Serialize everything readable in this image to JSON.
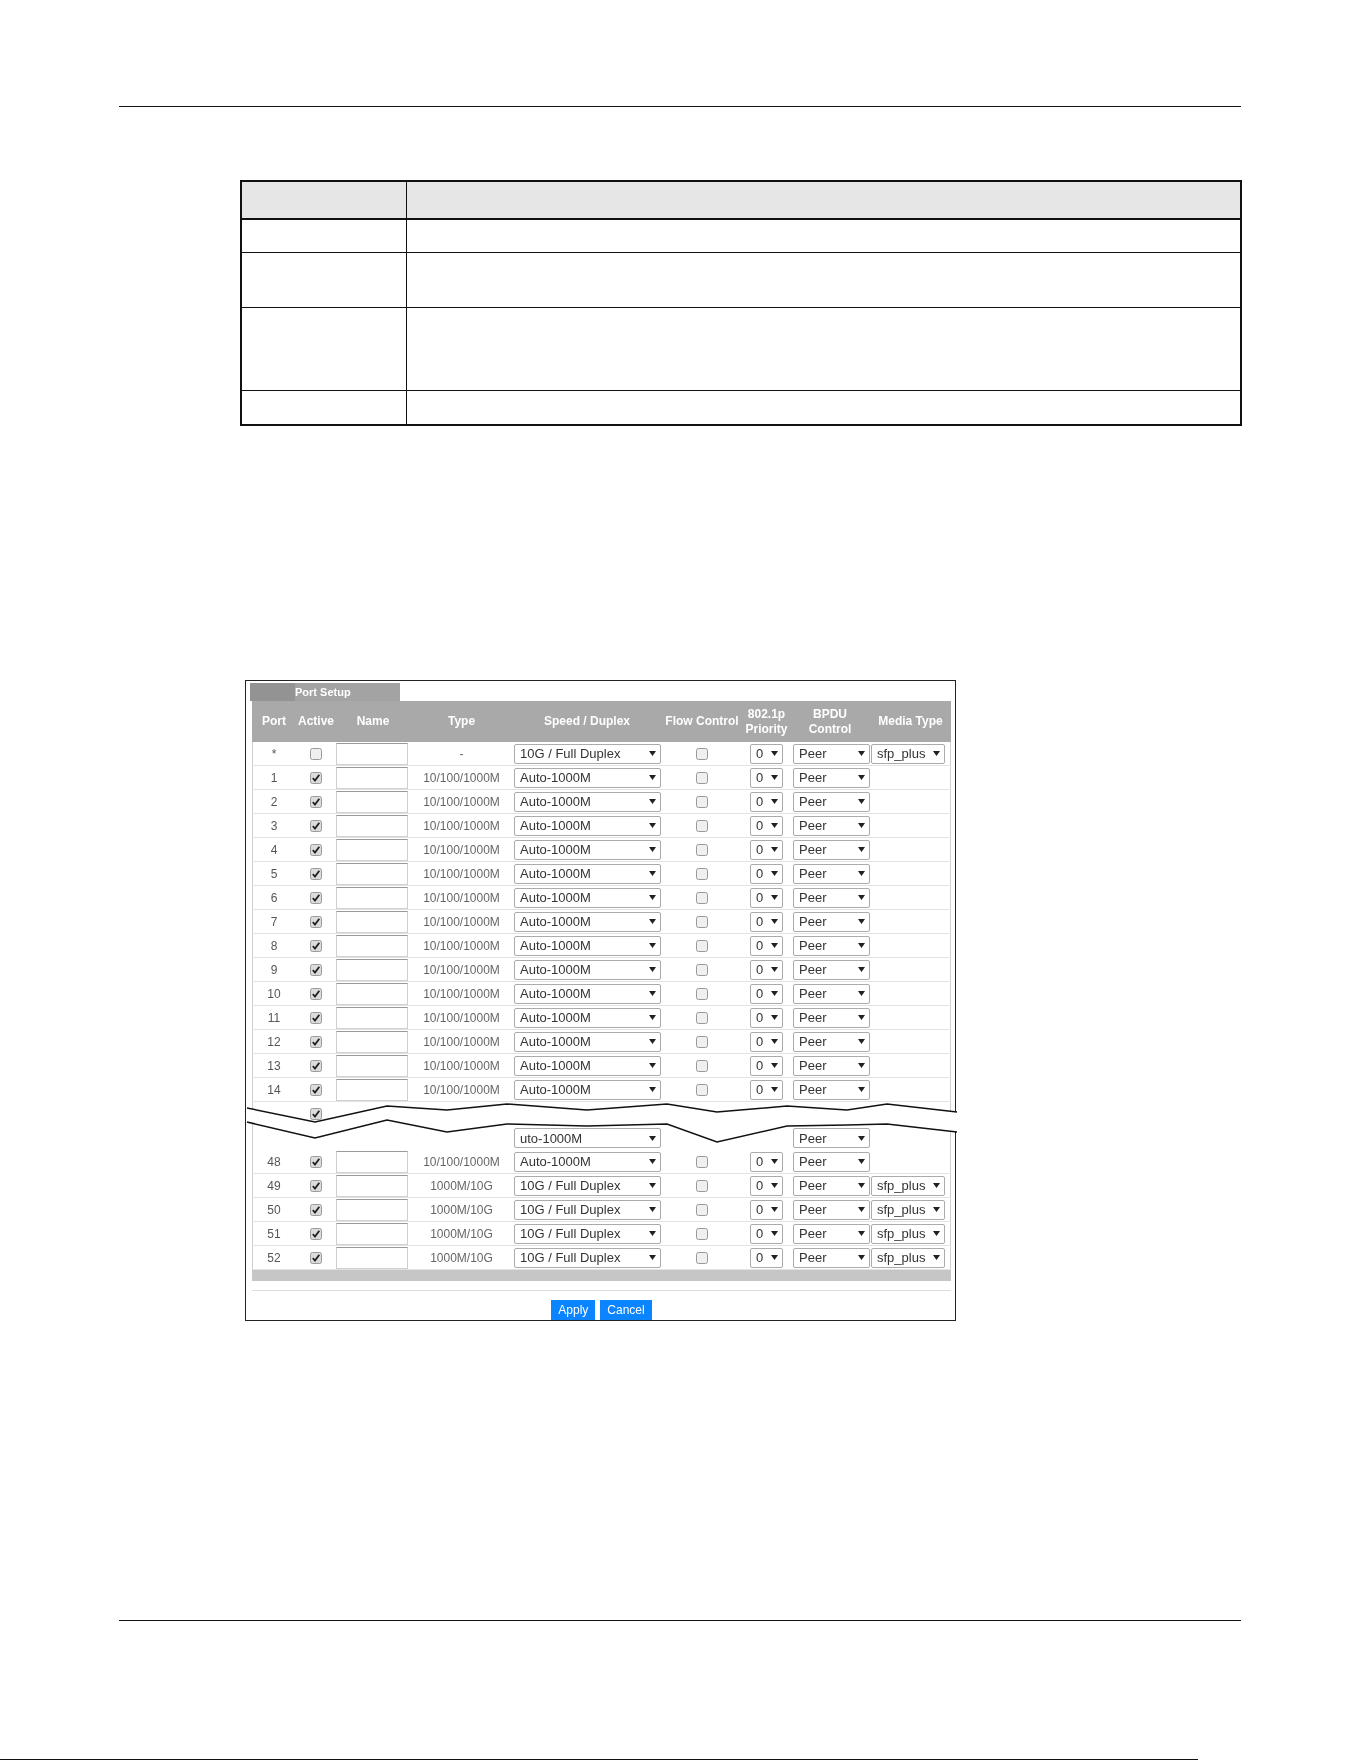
{
  "description_table": {
    "rows": [
      {
        "kind": "header"
      },
      {
        "kind": "single"
      },
      {
        "kind": "double"
      },
      {
        "kind": "triple"
      },
      {
        "kind": "single"
      }
    ]
  },
  "port_setup": {
    "title": "Port Setup",
    "columns": [
      "Port",
      "Active",
      "Name",
      "Type",
      "Speed / Duplex",
      "Flow Control",
      "802.1p Priority",
      "BPDU Control",
      "Media Type"
    ],
    "rows": [
      {
        "kind": "port",
        "port": "*",
        "active": false,
        "type": "-",
        "speed": "10G / Full Duplex",
        "flow_control": false,
        "priority": "0",
        "bpdu": "Peer",
        "media_type": "sfp_plus"
      },
      {
        "kind": "port",
        "port": "1",
        "active": true,
        "type": "10/100/1000M",
        "speed": "Auto-1000M",
        "flow_control": false,
        "priority": "0",
        "bpdu": "Peer"
      },
      {
        "kind": "port",
        "port": "2",
        "active": true,
        "type": "10/100/1000M",
        "speed": "Auto-1000M",
        "flow_control": false,
        "priority": "0",
        "bpdu": "Peer"
      },
      {
        "kind": "port",
        "port": "3",
        "active": true,
        "type": "10/100/1000M",
        "speed": "Auto-1000M",
        "flow_control": false,
        "priority": "0",
        "bpdu": "Peer"
      },
      {
        "kind": "port",
        "port": "4",
        "active": true,
        "type": "10/100/1000M",
        "speed": "Auto-1000M",
        "flow_control": false,
        "priority": "0",
        "bpdu": "Peer"
      },
      {
        "kind": "port",
        "port": "5",
        "active": true,
        "type": "10/100/1000M",
        "speed": "Auto-1000M",
        "flow_control": false,
        "priority": "0",
        "bpdu": "Peer"
      },
      {
        "kind": "port",
        "port": "6",
        "active": true,
        "type": "10/100/1000M",
        "speed": "Auto-1000M",
        "flow_control": false,
        "priority": "0",
        "bpdu": "Peer"
      },
      {
        "kind": "port",
        "port": "7",
        "active": true,
        "type": "10/100/1000M",
        "speed": "Auto-1000M",
        "flow_control": false,
        "priority": "0",
        "bpdu": "Peer"
      },
      {
        "kind": "port",
        "port": "8",
        "active": true,
        "type": "10/100/1000M",
        "speed": "Auto-1000M",
        "flow_control": false,
        "priority": "0",
        "bpdu": "Peer"
      },
      {
        "kind": "port",
        "port": "9",
        "active": true,
        "type": "10/100/1000M",
        "speed": "Auto-1000M",
        "flow_control": false,
        "priority": "0",
        "bpdu": "Peer"
      },
      {
        "kind": "port",
        "port": "10",
        "active": true,
        "type": "10/100/1000M",
        "speed": "Auto-1000M",
        "flow_control": false,
        "priority": "0",
        "bpdu": "Peer"
      },
      {
        "kind": "port",
        "port": "11",
        "active": true,
        "type": "10/100/1000M",
        "speed": "Auto-1000M",
        "flow_control": false,
        "priority": "0",
        "bpdu": "Peer"
      },
      {
        "kind": "port",
        "port": "12",
        "active": true,
        "type": "10/100/1000M",
        "speed": "Auto-1000M",
        "flow_control": false,
        "priority": "0",
        "bpdu": "Peer"
      },
      {
        "kind": "port",
        "port": "13",
        "active": true,
        "type": "10/100/1000M",
        "speed": "Auto-1000M",
        "flow_control": false,
        "priority": "0",
        "bpdu": "Peer"
      },
      {
        "kind": "port",
        "port": "14",
        "active": true,
        "type": "10/100/1000M",
        "speed": "Auto-1000M",
        "flow_control": false,
        "priority": "0",
        "bpdu": "Peer"
      },
      {
        "kind": "break",
        "above": {
          "active": true
        },
        "below": {
          "speed": "uto-1000M",
          "bpdu": "Peer"
        }
      },
      {
        "kind": "port",
        "port": "48",
        "active": true,
        "type": "10/100/1000M",
        "speed": "Auto-1000M",
        "flow_control": false,
        "priority": "0",
        "bpdu": "Peer"
      },
      {
        "kind": "port",
        "port": "49",
        "active": true,
        "type": "1000M/10G",
        "speed": "10G / Full Duplex",
        "flow_control": false,
        "priority": "0",
        "bpdu": "Peer",
        "media_type": "sfp_plus"
      },
      {
        "kind": "port",
        "port": "50",
        "active": true,
        "type": "1000M/10G",
        "speed": "10G / Full Duplex",
        "flow_control": false,
        "priority": "0",
        "bpdu": "Peer",
        "media_type": "sfp_plus"
      },
      {
        "kind": "port",
        "port": "51",
        "active": true,
        "type": "1000M/10G",
        "speed": "10G / Full Duplex",
        "flow_control": false,
        "priority": "0",
        "bpdu": "Peer",
        "media_type": "sfp_plus"
      },
      {
        "kind": "port",
        "port": "52",
        "active": true,
        "type": "1000M/10G",
        "speed": "10G / Full Duplex",
        "flow_control": false,
        "priority": "0",
        "bpdu": "Peer",
        "media_type": "sfp_plus"
      }
    ],
    "buttons": [
      "Apply",
      "Cancel"
    ]
  }
}
